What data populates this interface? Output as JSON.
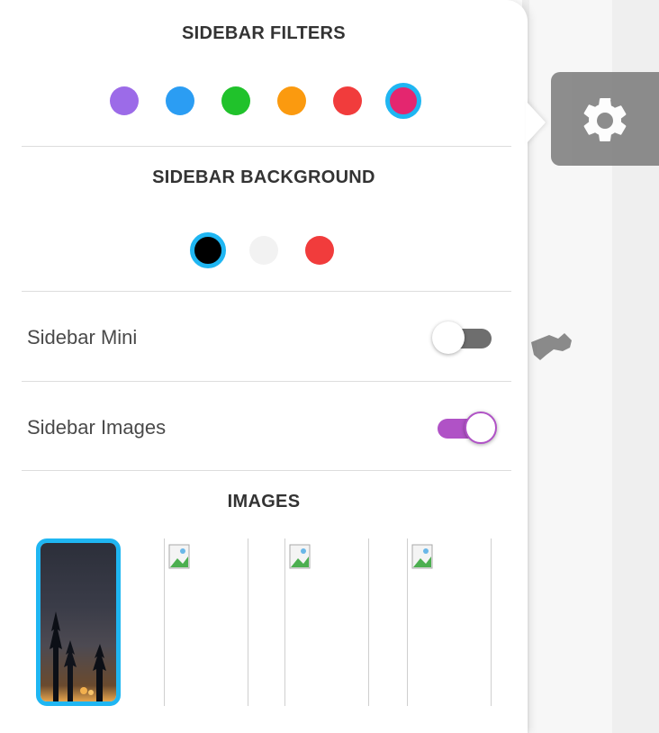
{
  "sidebar_filters": {
    "title": "SIDEBAR FILTERS",
    "colors": [
      {
        "name": "purple",
        "hex": "#9c6be8",
        "selected": false
      },
      {
        "name": "azure",
        "hex": "#2b9df3",
        "selected": false
      },
      {
        "name": "green",
        "hex": "#20c22b",
        "selected": false
      },
      {
        "name": "orange",
        "hex": "#fb9a0f",
        "selected": false
      },
      {
        "name": "red",
        "hex": "#f13c3c",
        "selected": false
      },
      {
        "name": "rose",
        "hex": "#e4266f",
        "selected": true
      }
    ]
  },
  "sidebar_background": {
    "title": "SIDEBAR BACKGROUND",
    "colors": [
      {
        "name": "black",
        "hex": "#000000",
        "selected": true
      },
      {
        "name": "white",
        "hex": "#f2f2f2",
        "selected": false
      },
      {
        "name": "red",
        "hex": "#f13c3c",
        "selected": false
      }
    ]
  },
  "toggles": {
    "sidebar_mini": {
      "label": "Sidebar Mini",
      "on": false
    },
    "sidebar_images": {
      "label": "Sidebar Images",
      "on": true
    }
  },
  "images": {
    "title": "IMAGES",
    "items": [
      {
        "kind": "night-sky-photo",
        "selected": true
      },
      {
        "kind": "broken-image-icon",
        "selected": false
      },
      {
        "kind": "broken-image-icon",
        "selected": false
      },
      {
        "kind": "broken-image-icon",
        "selected": false
      }
    ]
  },
  "settings_button": {
    "icon": "gear-icon"
  },
  "colors": {
    "selection_ring": "#1fb6f2",
    "toggle_on": "#b052c6",
    "toggle_off": "#6e6e6e"
  }
}
